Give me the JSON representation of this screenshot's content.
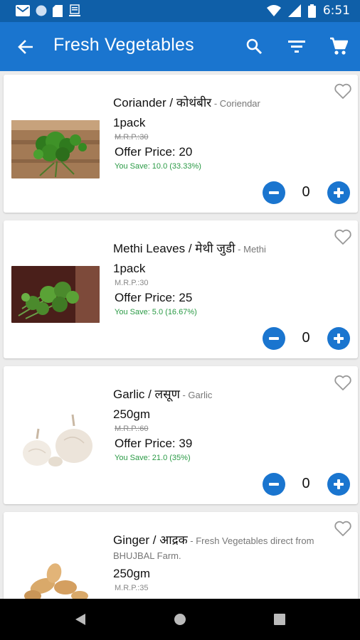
{
  "status_bar": {
    "time": "6:51",
    "icons": [
      "gmail-icon",
      "circle-icon",
      "sd-card-icon",
      "news-icon",
      "wifi-icon",
      "signal-icon",
      "battery-icon"
    ]
  },
  "app_bar": {
    "title": "Fresh Vegetables",
    "icons": [
      "back-arrow-icon",
      "search-icon",
      "filter-icon",
      "cart-icon"
    ]
  },
  "products": [
    {
      "name": "Coriander / कोथंबीर",
      "subtitle": " - Coriendar",
      "pack": "1pack",
      "mrp": "M.R.P.:30",
      "offer_price": "Offer Price: 20",
      "you_save": "You Save: 10.0 (33.33%)",
      "quantity": "0"
    },
    {
      "name": "Methi Leaves / मेथी जुडी",
      "subtitle": " - Methi",
      "pack": "1pack",
      "mrp": "M.R.P.:30",
      "offer_price": "Offer Price: 25",
      "you_save": "You Save: 5.0 (16.67%)",
      "quantity": "0"
    },
    {
      "name": "Garlic / लसूण",
      "subtitle": " - Garlic",
      "pack": "250gm",
      "mrp": "M.R.P.:60",
      "offer_price": "Offer Price: 39",
      "you_save": "You Save: 21.0 (35%)",
      "quantity": "0"
    },
    {
      "name": "Ginger / आद्रक",
      "subtitle": " - Fresh Vegetables direct from BHUJBAL Farm.",
      "pack": "250gm",
      "mrp": "M.R.P.:35"
    }
  ],
  "colors": {
    "status_bar": "#0f5fa8",
    "app_bar": "#1a75cf",
    "accent": "#1a75cf",
    "save_text": "#2a9a45"
  }
}
